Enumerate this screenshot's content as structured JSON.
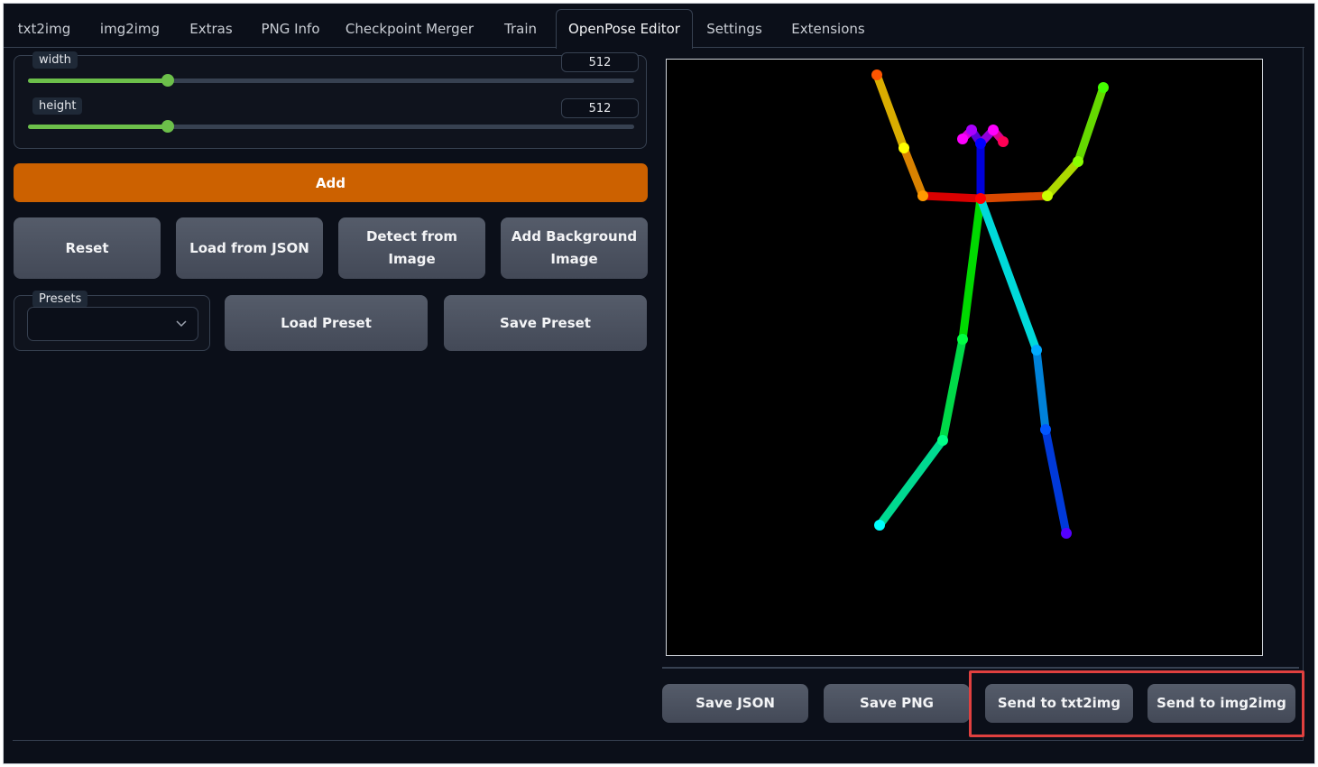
{
  "tabs": [
    {
      "label": "txt2img"
    },
    {
      "label": "img2img"
    },
    {
      "label": "Extras"
    },
    {
      "label": "PNG Info"
    },
    {
      "label": "Checkpoint Merger"
    },
    {
      "label": "Train"
    },
    {
      "label": "OpenPose Editor"
    },
    {
      "label": "Settings"
    },
    {
      "label": "Extensions"
    }
  ],
  "active_tab": "OpenPose Editor",
  "controls": {
    "width": {
      "label": "width",
      "value": "512",
      "fraction": 0.23
    },
    "height": {
      "label": "height",
      "value": "512",
      "fraction": 0.23
    }
  },
  "buttons": {
    "add": "Add",
    "reset": "Reset",
    "load_json": "Load from JSON",
    "detect_line1": "Detect from",
    "detect_line2": "Image",
    "add_bg_line1": "Add Background",
    "add_bg_line2": "Image",
    "load_preset": "Load Preset",
    "save_preset": "Save Preset",
    "save_json": "Save JSON",
    "save_png": "Save PNG",
    "send_txt2img": "Send to txt2img",
    "send_img2img": "Send to img2img"
  },
  "presets": {
    "label": "Presets",
    "selected": ""
  },
  "colors": {
    "accent": "#cc6100",
    "slider": "#6cbf4a",
    "highlight": "#e0403f",
    "background": "#0b0f19"
  }
}
